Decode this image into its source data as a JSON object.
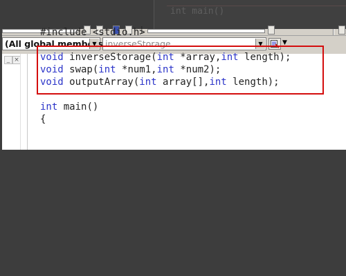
{
  "background_color": "#3d3d3d",
  "ghost_window": {
    "code_line": "int main()"
  },
  "toolbar": {
    "separator_text": "|"
  },
  "wizard_bar": {
    "class_combo": {
      "value": "(All global members",
      "arrow": "▼"
    },
    "member_combo": {
      "value": "inverseStorage",
      "arrow": "▼"
    },
    "action_dropdown_arrow": "▼"
  },
  "gutter": {
    "minimize_glyph": "_",
    "close_glyph": "×"
  },
  "code_lines": [
    {
      "parts": [
        {
          "t": "#include <stdio.h>",
          "k": false
        }
      ]
    },
    {
      "parts": []
    },
    {
      "parts": [
        {
          "t": "void",
          "k": true
        },
        {
          "t": " inverseStorage(",
          "k": false
        },
        {
          "t": "int",
          "k": true
        },
        {
          "t": " *array,",
          "k": false
        },
        {
          "t": "int",
          "k": true
        },
        {
          "t": " length);",
          "k": false
        }
      ]
    },
    {
      "parts": [
        {
          "t": "void",
          "k": true
        },
        {
          "t": " swap(",
          "k": false
        },
        {
          "t": "int",
          "k": true
        },
        {
          "t": " *num1,",
          "k": false
        },
        {
          "t": "int",
          "k": true
        },
        {
          "t": " *num2);",
          "k": false
        }
      ]
    },
    {
      "parts": [
        {
          "t": "void",
          "k": true
        },
        {
          "t": " outputArray(",
          "k": false
        },
        {
          "t": "int",
          "k": true
        },
        {
          "t": " array[],",
          "k": false
        },
        {
          "t": "int",
          "k": true
        },
        {
          "t": " length);",
          "k": false
        }
      ]
    },
    {
      "parts": []
    },
    {
      "parts": [
        {
          "t": "int",
          "k": true
        },
        {
          "t": " main()",
          "k": false
        }
      ]
    },
    {
      "parts": [
        {
          "t": "{",
          "k": false
        }
      ]
    }
  ],
  "colors": {
    "keyword": "#2b34c9",
    "highlight_border": "#d40c0c"
  }
}
